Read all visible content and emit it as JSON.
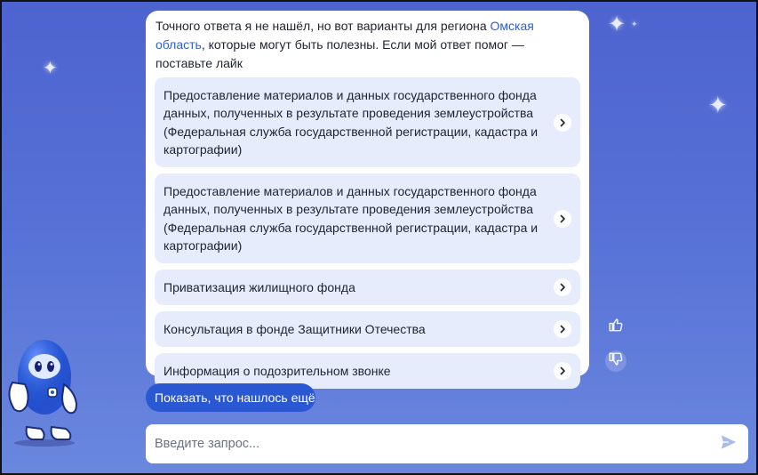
{
  "chat": {
    "intro_before": "Точного ответа я не нашёл, но вот варианты для региона ",
    "intro_region": "Омская область",
    "intro_after": ", которые могут быть полезны. Если мой ответ помог — поставьте лайк",
    "options": [
      {
        "label": "Предоставление материалов и данных государственного фонда данных, полученных в результате проведения землеустройства (Федеральная служба государственной регистрации, кадастра и картографии)"
      },
      {
        "label": "Предоставление материалов и данных государственного фонда данных, полученных в результате проведения землеустройства (Федеральная служба государственной регистрации, кадастра и картографии)"
      },
      {
        "label": "Приватизация жилищного фонда"
      },
      {
        "label": "Консультация в фонде Защитники Отечества"
      },
      {
        "label": "Информация о подозрительном звонке"
      }
    ]
  },
  "actions": {
    "show_more_label": "Показать, что нашлось ещё",
    "like_icon": "thumbs-up-icon",
    "dislike_icon": "thumbs-down-icon"
  },
  "input": {
    "placeholder": "Введите запрос...",
    "value": "",
    "send_icon": "send-icon"
  },
  "colors": {
    "background_top": "#4d63cf",
    "background_bottom": "#6a87de",
    "accent": "#2a58d3",
    "option_bg": "#e6ecfb",
    "link": "#2e5fd0"
  }
}
